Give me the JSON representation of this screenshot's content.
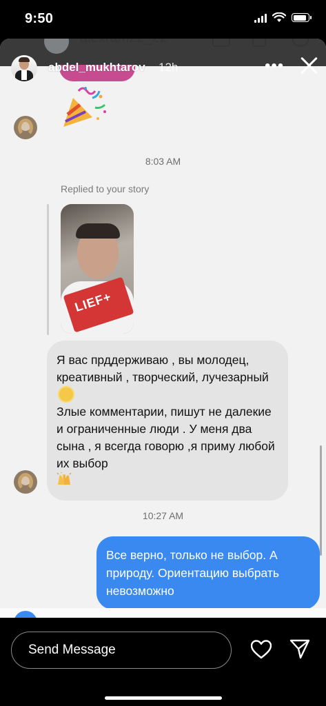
{
  "status_bar": {
    "time": "9:50",
    "battery_level": 0.9
  },
  "underlay": {
    "title": "alexram22_22"
  },
  "story": {
    "username": "abdel_mukhtarov",
    "age": "12h",
    "more_label": "•••",
    "icons": {
      "close": "close-icon",
      "more": "more-icon"
    }
  },
  "chat": {
    "timestamp_1": "8:03 AM",
    "reply_label": "Replied to your story",
    "story_thumb_text": "LIEF+",
    "incoming_message": {
      "line_1": "Я вас прддерживаю , вы молодец, креативный , творческий, лучезарный",
      "line_2": "Злые комментарии, пишут не далекие и ограниченные люди . У меня два сына , я всегда говорю ,я приму любой их выбор"
    },
    "timestamp_2": "10:27 AM",
    "outgoing_message": "Все верно, только не выбор. А природу. Ориентацию выбрать невозможно"
  },
  "composer": {
    "placeholder": "Send Message",
    "icons": {
      "like": "heart-icon",
      "send": "send-icon"
    }
  },
  "colors": {
    "outgoing_bubble": "#3a89f1",
    "incoming_bubble": "#e4e4e4",
    "background": "#f2f2f2"
  }
}
